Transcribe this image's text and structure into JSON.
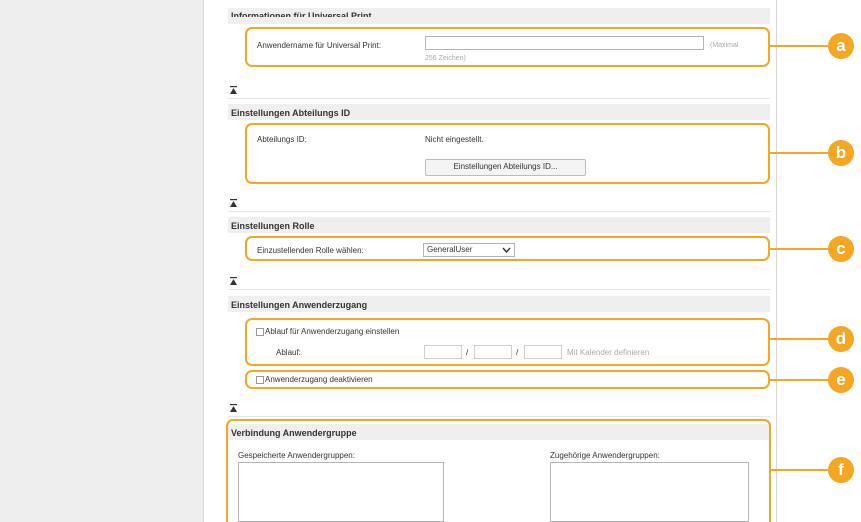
{
  "universal_print": {
    "section_title": "Informationen für Universal Print",
    "username_label": "Anwendername für Universal Print:",
    "username_value": "",
    "max_note_line1": "(Maximal",
    "max_note_line2": "256 Zeichen)"
  },
  "department_id": {
    "section_title": "Einstellungen Abteilungs ID",
    "label": "Abteilungs ID:",
    "value": "Nicht eingestellt.",
    "button_label": "Einstellungen Abteilungs ID..."
  },
  "role": {
    "section_title": "Einstellungen Rolle",
    "label": "Einzustellenden Rolle wählen:",
    "selected": "GeneralUser"
  },
  "user_access": {
    "section_title": "Einstellungen Anwenderzugang",
    "expiry_checkbox_label": "Ablauf für Anwenderzugang einstellen",
    "expiry_checked": false,
    "expiry_label": "Ablauf:",
    "date_separator_1": "/",
    "date_separator_2": "/",
    "calendar_link": "Mit Kalender definieren",
    "disable_checkbox_label": "Anwenderzugang deaktivieren",
    "disable_checked": false
  },
  "user_group": {
    "section_title": "Verbindung Anwendergruppe",
    "saved_groups_label": "Gespeicherte Anwendergruppen:",
    "assigned_groups_label": "Zugehörige Anwendergruppen:"
  },
  "callouts": [
    "a",
    "b",
    "c",
    "d",
    "e",
    "f"
  ],
  "icons": {
    "back_to_top": "back-to-top-icon",
    "select_arrow": "chevron-down-icon"
  },
  "colors": {
    "highlight": "#f5a623",
    "section_bg": "#efefef",
    "sidebar_bg": "#eeeeee"
  }
}
